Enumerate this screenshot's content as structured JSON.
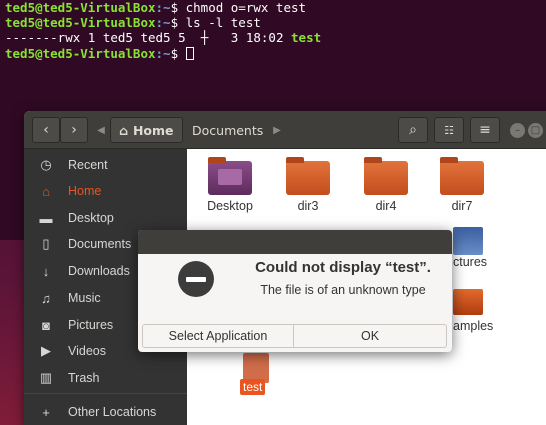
{
  "terminal": {
    "lines": [
      {
        "user": "ted5@ted5-VirtualBox",
        "path": ":~",
        "cmd": "$ chmod o=rwx test"
      },
      {
        "user": "ted5@ted5-VirtualBox",
        "path": ":~",
        "cmd": "$ ls -l test"
      },
      {
        "output": "-------rwx 1 ted5 ted5 5",
        "cursor_glyph": "┼",
        "output_tail": "   3 18:02 ",
        "file": "test"
      },
      {
        "user": "ted5@ted5-VirtualBox",
        "path": ":~",
        "cmd": "$ "
      }
    ],
    "colors": {
      "background": "#300a24",
      "user": "#8ae234",
      "path": "#729fcf"
    }
  },
  "file_manager": {
    "header": {
      "back_icon": "chevron-left-icon",
      "forward_icon": "chevron-right-icon",
      "home_crumb": "Home",
      "documents_crumb": "Documents",
      "home_icon": "home-icon",
      "search_icon": "search-icon",
      "view_icon": "view-toggle-icon",
      "menu_icon": "hamburger-menu-icon"
    },
    "sidebar": {
      "items": [
        {
          "label": "Recent",
          "icon": "clock-icon"
        },
        {
          "label": "Home",
          "icon": "home-icon"
        },
        {
          "label": "Desktop",
          "icon": "folder-icon"
        },
        {
          "label": "Documents",
          "icon": "document-icon"
        },
        {
          "label": "Downloads",
          "icon": "download-icon"
        },
        {
          "label": "Music",
          "icon": "music-icon"
        },
        {
          "label": "Pictures",
          "icon": "camera-icon"
        },
        {
          "label": "Videos",
          "icon": "video-icon"
        },
        {
          "label": "Trash",
          "icon": "trash-icon"
        },
        {
          "label": "Other Locations",
          "icon": "plus-icon"
        }
      ]
    },
    "content": {
      "tiles": [
        "Desktop",
        "dir3",
        "dir4",
        "dir7"
      ],
      "partial_tiles": [
        "ctures",
        "amples"
      ],
      "selected_file": "test"
    },
    "colors": {
      "accent": "#e95420",
      "sidebar": "#333333",
      "headerbar": "#3f3e3b"
    }
  },
  "dialog": {
    "title": "Could not display “test”.",
    "message": "The file is of an unknown type",
    "icon": "error-minus-icon",
    "buttons": {
      "select": "Select Application",
      "ok": "OK"
    }
  }
}
